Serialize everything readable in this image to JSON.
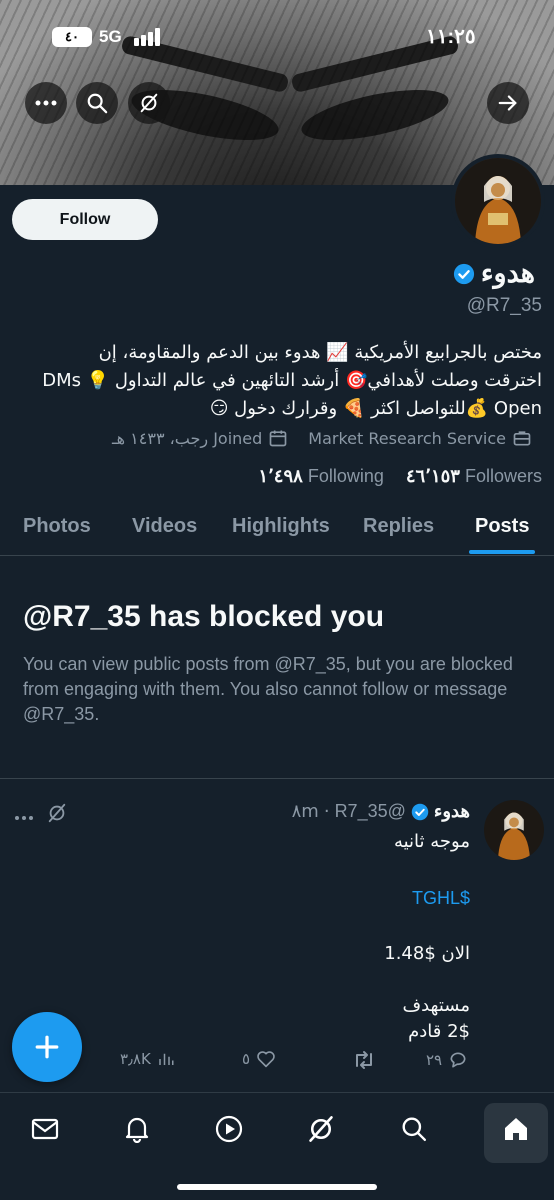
{
  "status_bar": {
    "battery": "٤٠",
    "network": "5G",
    "time": "١١:٢٥"
  },
  "profile": {
    "follow_label": "Follow",
    "display_name": "هدوء",
    "handle": "@R7_35",
    "bio_lines": [
      "مختص بالجرابيع الأمريكية 📈 هدوء بين الدعم والمقاومة، إن",
      "اخترقت وصلت لأهدافي🎯 أرشد التائهين في عالم التداول 💡 DMs",
      "Open 💰للتواصل اكثر 🍕 وقرارك دخول 😏"
    ],
    "category": "Market Research Service",
    "joined": "Joined رجب، ١٤٣٣ هـ",
    "following_count": "١٬٤٩٨",
    "following_label": "Following",
    "followers_count": "٤٦٬١٥٣",
    "followers_label": "Followers"
  },
  "tabs": [
    "Photos",
    "Videos",
    "Highlights",
    "Replies",
    "Posts"
  ],
  "active_tab": "Posts",
  "blocked": {
    "title": "@R7_35 has blocked you",
    "body": "You can view public posts from @R7_35, but you are blocked from engaging with them. You also cannot follow or message @R7_35."
  },
  "post": {
    "author": "هدوء",
    "handle": "@R7_35",
    "time": "٨m",
    "lines": [
      "موجه ثانيه",
      "$TGHL",
      "الان $1.48",
      "مستهدف",
      "2$ قادم"
    ],
    "views": "٣٫٨K",
    "likes": "٥",
    "replies": "٢٩"
  },
  "colors": {
    "background": "#15202b",
    "accent": "#1d9bf0",
    "muted": "#8b98a5",
    "divider": "#38444d"
  }
}
